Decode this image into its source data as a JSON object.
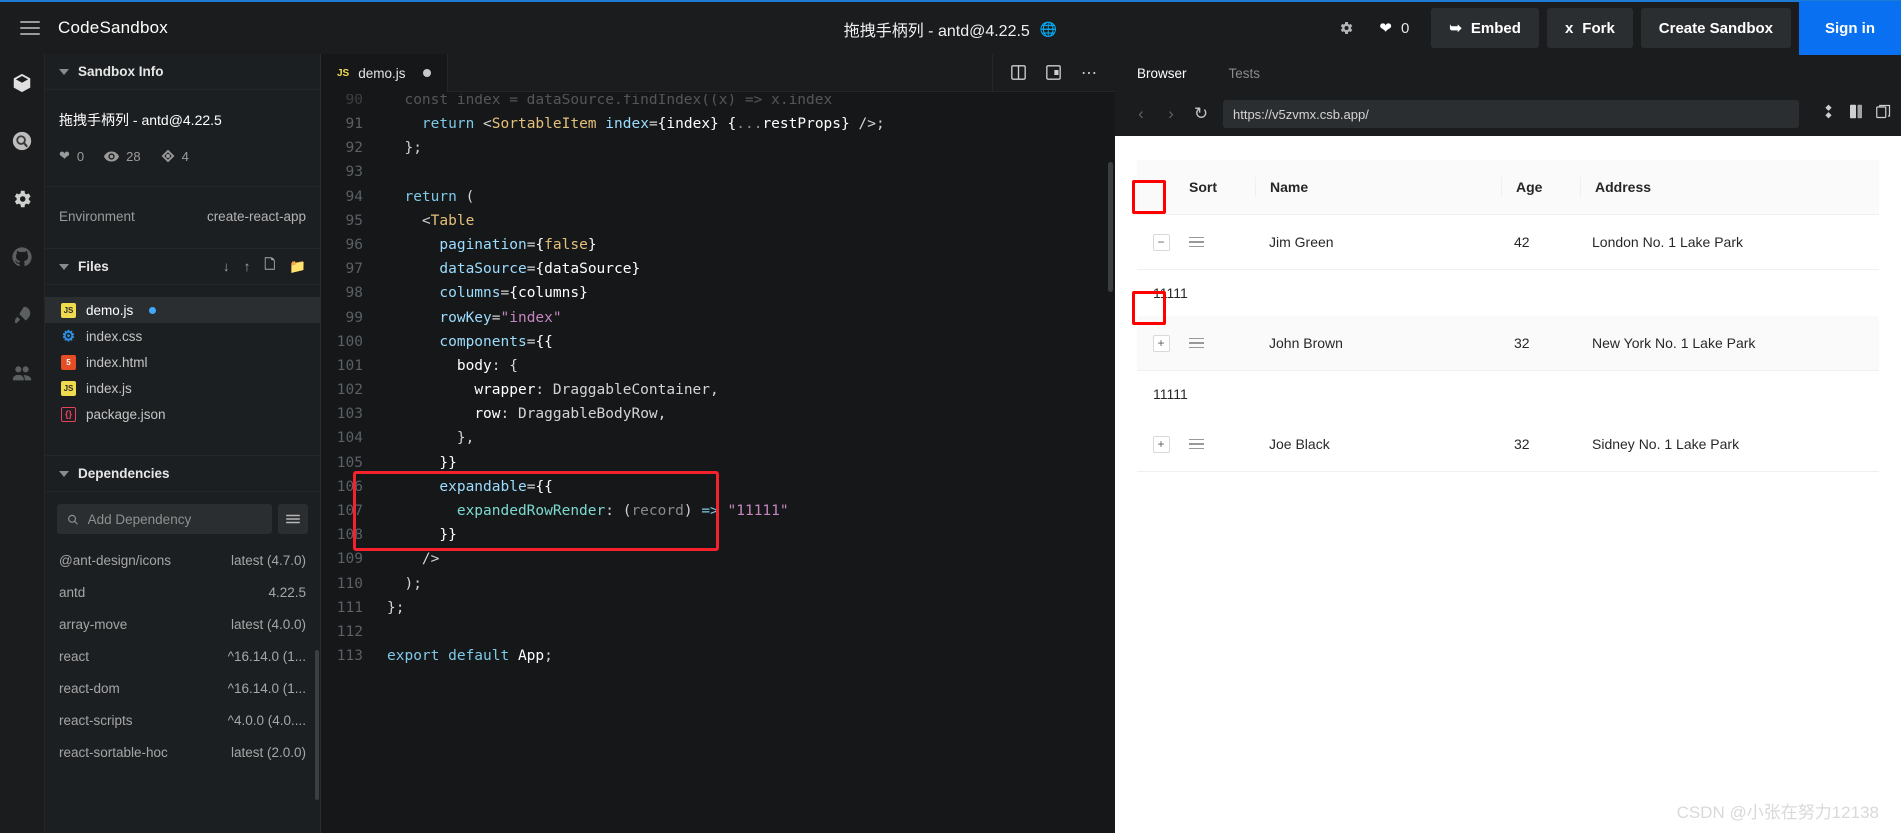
{
  "topbar": {
    "menu_icon": "hamburger-icon",
    "brand": "CodeSandbox",
    "title": "拖拽手柄列 - antd@4.22.5",
    "globe_icon": "globe-icon",
    "settings_icon": "gear-icon",
    "like_icon": "heart-icon",
    "like_count": "0",
    "embed_label": "Embed",
    "embed_icon": "share-arrow-icon",
    "fork_label": "Fork",
    "fork_icon": "fork-icon",
    "create_label": "Create Sandbox",
    "signin_label": "Sign in"
  },
  "activity_bar": {
    "items": [
      {
        "name": "explorer-cube-icon"
      },
      {
        "name": "search-icon"
      },
      {
        "name": "gear-icon"
      },
      {
        "name": "github-icon"
      },
      {
        "name": "rocket-deploy-icon"
      },
      {
        "name": "live-collab-icon"
      }
    ]
  },
  "sidebar": {
    "sandbox_info": {
      "header": "Sandbox Info",
      "title": "拖拽手柄列 - antd@4.22.5",
      "stats": [
        {
          "icon": "heart-icon",
          "value": "0"
        },
        {
          "icon": "eye-icon",
          "value": "28"
        },
        {
          "icon": "fork-icon",
          "value": "4"
        }
      ],
      "environment_label": "Environment",
      "environment_value": "create-react-app"
    },
    "files": {
      "header": "Files",
      "actions": [
        "download-icon",
        "upload-icon",
        "new-file-icon",
        "new-folder-icon"
      ],
      "items": [
        {
          "name": "demo.js",
          "type": "js",
          "active": true,
          "modified": true
        },
        {
          "name": "index.css",
          "type": "css",
          "active": false,
          "modified": false
        },
        {
          "name": "index.html",
          "type": "html",
          "active": false,
          "modified": false
        },
        {
          "name": "index.js",
          "type": "js",
          "active": false,
          "modified": false
        },
        {
          "name": "package.json",
          "type": "json",
          "active": false,
          "modified": false
        }
      ]
    },
    "dependencies": {
      "header": "Dependencies",
      "search_placeholder": "Add Dependency",
      "search_value": "",
      "menu_icon": "list-menu-icon",
      "items": [
        {
          "name": "@ant-design/icons",
          "version": "latest (4.7.0)"
        },
        {
          "name": "antd",
          "version": "4.22.5"
        },
        {
          "name": "array-move",
          "version": "latest (4.0.0)"
        },
        {
          "name": "react",
          "version": "^16.14.0 (1..."
        },
        {
          "name": "react-dom",
          "version": "^16.14.0 (1..."
        },
        {
          "name": "react-scripts",
          "version": "^4.0.0 (4.0...."
        },
        {
          "name": "react-sortable-hoc",
          "version": "latest (2.0.0)"
        }
      ]
    }
  },
  "editor": {
    "tabs": [
      {
        "label": "demo.js",
        "type": "js",
        "modified": true,
        "active": true
      }
    ],
    "actions": [
      "split-editor-icon",
      "open-preview-icon",
      "more-options-icon"
    ],
    "code_lines": [
      {
        "n": "90",
        "partial": true,
        "tokens": [
          {
            "t": "  const index = dataSource.findIndex((x) => x.index ",
            "c": "k-dim"
          }
        ]
      },
      {
        "n": "91",
        "tokens": [
          {
            "t": "    ",
            "c": "k-pl"
          },
          {
            "t": "return",
            "c": "k-kw"
          },
          {
            "t": " <",
            "c": "k-pl"
          },
          {
            "t": "SortableItem",
            "c": "k-tag"
          },
          {
            "t": " ",
            "c": "k-pl"
          },
          {
            "t": "index",
            "c": "k-key"
          },
          {
            "t": "=",
            "c": "k-pl"
          },
          {
            "t": "{index}",
            "c": "k-white"
          },
          {
            "t": " ",
            "c": "k-pl"
          },
          {
            "t": "{",
            "c": "k-white"
          },
          {
            "t": "...",
            "c": "k-dim"
          },
          {
            "t": "restProps}",
            "c": "k-white"
          },
          {
            "t": " />;",
            "c": "k-pl"
          }
        ]
      },
      {
        "n": "92",
        "tokens": [
          {
            "t": "  };",
            "c": "k-pl"
          }
        ]
      },
      {
        "n": "93",
        "tokens": []
      },
      {
        "n": "94",
        "tokens": [
          {
            "t": "  ",
            "c": "k-pl"
          },
          {
            "t": "return",
            "c": "k-kw"
          },
          {
            "t": " (",
            "c": "k-pl"
          }
        ]
      },
      {
        "n": "95",
        "tokens": [
          {
            "t": "    <",
            "c": "k-pl"
          },
          {
            "t": "Table",
            "c": "k-tag"
          }
        ]
      },
      {
        "n": "96",
        "tokens": [
          {
            "t": "      ",
            "c": "k-pl"
          },
          {
            "t": "pagination",
            "c": "k-key"
          },
          {
            "t": "=",
            "c": "k-pl"
          },
          {
            "t": "{",
            "c": "k-white"
          },
          {
            "t": "false",
            "c": "k-bool"
          },
          {
            "t": "}",
            "c": "k-white"
          }
        ]
      },
      {
        "n": "97",
        "tokens": [
          {
            "t": "      ",
            "c": "k-pl"
          },
          {
            "t": "dataSource",
            "c": "k-key"
          },
          {
            "t": "=",
            "c": "k-pl"
          },
          {
            "t": "{dataSource}",
            "c": "k-white"
          }
        ]
      },
      {
        "n": "98",
        "tokens": [
          {
            "t": "      ",
            "c": "k-pl"
          },
          {
            "t": "columns",
            "c": "k-key"
          },
          {
            "t": "=",
            "c": "k-pl"
          },
          {
            "t": "{columns}",
            "c": "k-white"
          }
        ]
      },
      {
        "n": "99",
        "tokens": [
          {
            "t": "      ",
            "c": "k-pl"
          },
          {
            "t": "rowKey",
            "c": "k-key"
          },
          {
            "t": "=",
            "c": "k-pl"
          },
          {
            "t": "\"index\"",
            "c": "k-str"
          }
        ]
      },
      {
        "n": "100",
        "tokens": [
          {
            "t": "      ",
            "c": "k-pl"
          },
          {
            "t": "components",
            "c": "k-key"
          },
          {
            "t": "=",
            "c": "k-pl"
          },
          {
            "t": "{{",
            "c": "k-white"
          }
        ]
      },
      {
        "n": "101",
        "tokens": [
          {
            "t": "        ",
            "c": "k-pl"
          },
          {
            "t": "body",
            "c": "k-white"
          },
          {
            "t": ": {",
            "c": "k-pl"
          }
        ]
      },
      {
        "n": "102",
        "tokens": [
          {
            "t": "          ",
            "c": "k-pl"
          },
          {
            "t": "wrapper",
            "c": "k-white"
          },
          {
            "t": ": DraggableContainer,",
            "c": "k-pl"
          }
        ]
      },
      {
        "n": "103",
        "tokens": [
          {
            "t": "          ",
            "c": "k-pl"
          },
          {
            "t": "row",
            "c": "k-white"
          },
          {
            "t": ": DraggableBodyRow,",
            "c": "k-pl"
          }
        ]
      },
      {
        "n": "104",
        "tokens": [
          {
            "t": "        },",
            "c": "k-pl"
          }
        ]
      },
      {
        "n": "105",
        "tokens": [
          {
            "t": "      ",
            "c": "k-pl"
          },
          {
            "t": "}}",
            "c": "k-white"
          }
        ]
      },
      {
        "n": "106",
        "tokens": [
          {
            "t": "      ",
            "c": "k-pl"
          },
          {
            "t": "expandable",
            "c": "k-key"
          },
          {
            "t": "=",
            "c": "k-pl"
          },
          {
            "t": "{{",
            "c": "k-white"
          }
        ]
      },
      {
        "n": "107",
        "tokens": [
          {
            "t": "        ",
            "c": "k-pl"
          },
          {
            "t": "expandedRowRender",
            "c": "k-fn"
          },
          {
            "t": ": (",
            "c": "k-pl"
          },
          {
            "t": "record",
            "c": "k-dim"
          },
          {
            "t": ") ",
            "c": "k-pl"
          },
          {
            "t": "=>",
            "c": "k-kw"
          },
          {
            "t": " ",
            "c": "k-pl"
          },
          {
            "t": "\"11111\"",
            "c": "k-str"
          }
        ]
      },
      {
        "n": "108",
        "tokens": [
          {
            "t": "      ",
            "c": "k-pl"
          },
          {
            "t": "}}",
            "c": "k-white"
          }
        ]
      },
      {
        "n": "109",
        "tokens": [
          {
            "t": "    />",
            "c": "k-pl"
          }
        ]
      },
      {
        "n": "110",
        "tokens": [
          {
            "t": "  );",
            "c": "k-pl"
          }
        ]
      },
      {
        "n": "111",
        "tokens": [
          {
            "t": "};",
            "c": "k-pl"
          }
        ]
      },
      {
        "n": "112",
        "tokens": []
      },
      {
        "n": "113",
        "tokens": [
          {
            "t": "export default",
            "c": "k-kw"
          },
          {
            "t": " ",
            "c": "k-pl"
          },
          {
            "t": "App",
            "c": "k-white"
          },
          {
            "t": ";",
            "c": "k-pl"
          }
        ]
      }
    ]
  },
  "preview": {
    "tabs": [
      {
        "label": "Browser",
        "active": true
      },
      {
        "label": "Tests",
        "active": false
      }
    ],
    "nav": {
      "back_icon": "chevron-left-icon",
      "forward_icon": "chevron-right-icon",
      "reload_icon": "reload-icon"
    },
    "url": "https://v5zvmx.csb.app/",
    "actions": [
      "responsive-icon",
      "open-new-window-icon",
      "split-view-icon"
    ],
    "table": {
      "columns": [
        "Sort",
        "Name",
        "Age",
        "Address"
      ],
      "rows": [
        {
          "expanded": true,
          "expand_icon": "minus",
          "highlighted": true,
          "drag_icon": "drag-handle-icon",
          "name": "Jim Green",
          "age": "42",
          "address": "London No. 1 Lake Park",
          "expanded_content": "11111",
          "alt": false
        },
        {
          "expanded": false,
          "expand_icon": "plus",
          "highlighted": true,
          "drag_icon": "drag-handle-icon",
          "name": "John Brown",
          "age": "32",
          "address": "New York No. 1 Lake Park",
          "expanded_content": "11111",
          "alt": true
        },
        {
          "expanded": false,
          "expand_icon": "plus",
          "highlighted": false,
          "drag_icon": "drag-handle-icon",
          "name": "Joe Black",
          "age": "32",
          "address": "Sidney No. 1 Lake Park",
          "expanded_content": "",
          "alt": false
        }
      ]
    }
  },
  "watermark": "CSDN @小张在努力12138",
  "colors": {
    "accent_blue": "#0971f1",
    "highlight_red": "#ff0000",
    "code_highlight_red": "#f5222d",
    "topbar_border": "#1f7cd6"
  }
}
